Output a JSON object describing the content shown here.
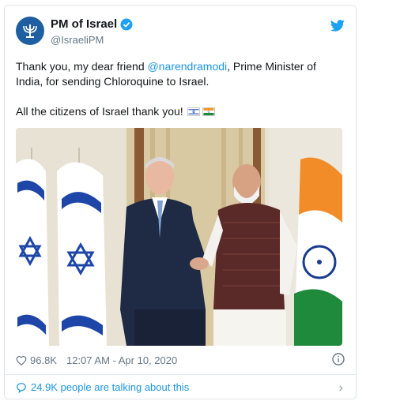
{
  "author": {
    "display_name": "PM of Israel",
    "handle": "@IsraeliPM"
  },
  "tweet": {
    "line1_prefix": "Thank you, my dear friend ",
    "mention": "@narendramodi",
    "line1_suffix": ", Prime Minister of India, for sending Chloroquine to Israel.",
    "line2": "All the citizens of Israel thank you!"
  },
  "stats": {
    "likes": "96.8K",
    "timestamp": "12:07 AM - Apr 10, 2020"
  },
  "conversation": {
    "label": "24.9K people are talking about this"
  },
  "icons": {
    "verified": "verified-badge-icon",
    "brand": "twitter-bird-icon",
    "like": "heart-icon",
    "info": "info-icon",
    "reply": "speech-bubble-icon",
    "more": "chevron-right-icon"
  },
  "colors": {
    "link": "#1b95e0",
    "muted": "#657786",
    "avatar": "#1d5fa0"
  }
}
